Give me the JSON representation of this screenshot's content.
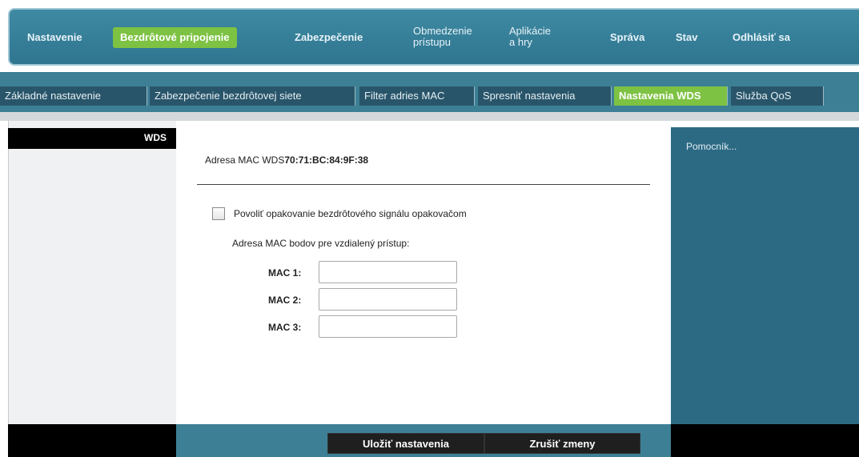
{
  "nav": {
    "items": [
      {
        "label": "Nastavenie"
      },
      {
        "label": "Bezdrôtové pripojenie"
      },
      {
        "label": "Zabezpečenie"
      },
      {
        "line1": "Obmedzenie",
        "line2": "prístupu"
      },
      {
        "line1": "Aplikácie",
        "line2": "a hry"
      },
      {
        "label": "Správa"
      },
      {
        "label": "Stav"
      },
      {
        "label": "Odhlásiť sa"
      }
    ]
  },
  "tabs": [
    {
      "label": "Základné nastavenie"
    },
    {
      "label": "Zabezpečenie bezdrôtovej siete"
    },
    {
      "label": "Filter adries MAC"
    },
    {
      "label": "Spresniť nastavenia"
    },
    {
      "label": "Nastavenia WDS"
    },
    {
      "label": "Služba QoS"
    }
  ],
  "left": {
    "heading": "WDS"
  },
  "main": {
    "mac_label": "Adresa MAC WDS",
    "mac_value": "70:71:BC:84:9F:38",
    "checkbox_label": "Povoliť opakovanie bezdrôtového signálu opakovačom",
    "remote_label": "Adresa MAC bodov pre vzdialený prístup:",
    "mac_fields": [
      {
        "label": "MAC 1:",
        "value": ""
      },
      {
        "label": "MAC 2:",
        "value": ""
      },
      {
        "label": "MAC 3:",
        "value": ""
      }
    ]
  },
  "help": {
    "label": "Pomocník..."
  },
  "buttons": {
    "save": "Uložiť nastavenia",
    "cancel": "Zrušiť zmeny"
  },
  "colors": {
    "accent": "#7dc242",
    "nav_bg": "#3d8095",
    "help_bg": "#2c6a84"
  }
}
